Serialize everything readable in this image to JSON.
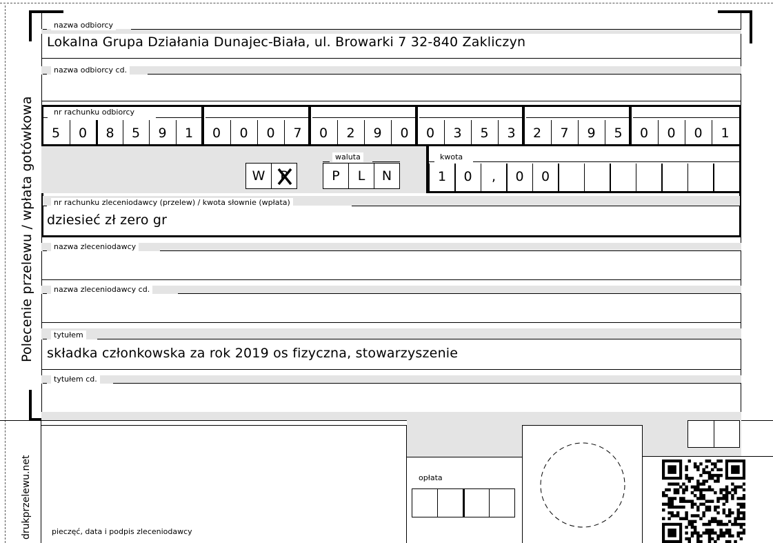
{
  "side_label": "Polecenie przelewu / wpłata gotówkowa",
  "site_label": "drukprzelewu.net",
  "recipient": {
    "label": "nazwa odbiorcy",
    "value": "Lokalna Grupa Działania Dunajec-Biała, ul. Browarki 7 32-840 Zakliczyn"
  },
  "recipient_cont": {
    "label": "nazwa odbiorcy cd.",
    "value": ""
  },
  "account": {
    "label": "nr rachunku odbiorcy",
    "digits": [
      "5",
      "0",
      "8",
      "5",
      "9",
      "1",
      "0",
      "0",
      "0",
      "7",
      "0",
      "2",
      "9",
      "0",
      "0",
      "3",
      "5",
      "3",
      "2",
      "7",
      "9",
      "5",
      "0",
      "0",
      "0",
      "1"
    ]
  },
  "transfer_type": {
    "w": "W",
    "p": "P"
  },
  "currency": {
    "label": "waluta",
    "chars": [
      "P",
      "L",
      "N"
    ]
  },
  "amount": {
    "label": "kwota",
    "chars": [
      "1",
      "0",
      ",",
      "0",
      "0",
      "",
      "",
      "",
      "",
      "",
      "",
      ""
    ]
  },
  "amount_words": {
    "label": "nr rachunku zleceniodawcy (przelew) / kwota słownie (wpłata)",
    "value": "dziesieć zł zero gr"
  },
  "payer": {
    "label": "nazwa zleceniodawcy",
    "value": ""
  },
  "payer_cont": {
    "label": "nazwa zleceniodawcy cd.",
    "value": ""
  },
  "title": {
    "label": "tytułem",
    "value": "składka członkowska za rok 2019 os fizyczna, stowarzyszenie"
  },
  "title_cont": {
    "label": "tytułem cd.",
    "value": ""
  },
  "signature_label": "pieczęć, data i podpis zleceniodawcy",
  "fee_label": "opłata"
}
